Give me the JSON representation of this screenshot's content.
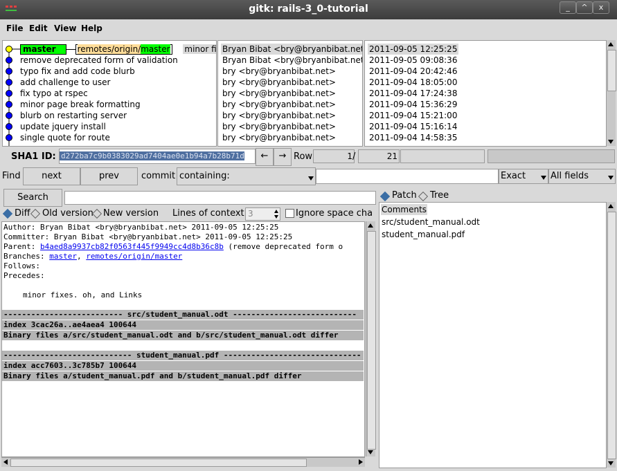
{
  "window": {
    "title": "gitk: rails-3_0-tutorial"
  },
  "menu": [
    "File",
    "Edit",
    "View",
    "Help"
  ],
  "commits": [
    {
      "subject": "minor fixes. o",
      "author": "Bryan Bibat <bry@bryanbibat.net>",
      "date": "2011-09-05 12:25:25"
    },
    {
      "subject": "remove deprecated form of validation",
      "author": "Bryan Bibat <bry@bryanbibat.net>",
      "date": "2011-09-05 09:08:36"
    },
    {
      "subject": "typo fix and add code blurb",
      "author": "bry <bry@bryanbibat.net>",
      "date": "2011-09-04 20:42:46"
    },
    {
      "subject": "add challenge to user",
      "author": "bry <bry@bryanbibat.net>",
      "date": "2011-09-04 18:05:00"
    },
    {
      "subject": "fix typo at rspec",
      "author": "bry <bry@bryanbibat.net>",
      "date": "2011-09-04 17:24:38"
    },
    {
      "subject": "minor page break formatting",
      "author": "bry <bry@bryanbibat.net>",
      "date": "2011-09-04 15:36:29"
    },
    {
      "subject": "blurb on restarting server",
      "author": "bry <bry@bryanbibat.net>",
      "date": "2011-09-04 15:21:00"
    },
    {
      "subject": "update jquery install",
      "author": "bry <bry@bryanbibat.net>",
      "date": "2011-09-04 15:16:14"
    },
    {
      "subject": "single quote for route",
      "author": "bry <bry@bryanbibat.net>",
      "date": "2011-09-04 14:58:35"
    }
  ],
  "refs": {
    "branch": "master",
    "remote_prefix": "remotes/origin/",
    "remote_branch": "master"
  },
  "sha": {
    "label": "SHA1 ID:",
    "value": "d272ba7c9b0383029ad7404ae0e1b94a7b28b71d",
    "row_label": "Row",
    "row_current": "1",
    "row_sep": "/",
    "row_total": "21"
  },
  "find": {
    "label": "Find",
    "next": "next",
    "prev": "prev",
    "commit_label": "commit",
    "mode": "containing:",
    "exact": "Exact",
    "fields": "All fields"
  },
  "search": {
    "button": "Search"
  },
  "diffopts": {
    "diff": "Diff",
    "old": "Old version",
    "new": "New version",
    "context_label": "Lines of context:",
    "context_value": "3",
    "ignore_space": "Ignore space chan"
  },
  "details": {
    "author": "Author: Bryan Bibat <bry@bryanbibat.net>  2011-09-05 12:25:25",
    "committer": "Committer: Bryan Bibat <bry@bryanbibat.net>  2011-09-05 12:25:25",
    "parent_label": "Parent: ",
    "parent_sha": "b4aed8a9937cb82f0563f445f9949cc4d8b36c8b",
    "parent_desc": " (remove deprecated form o",
    "branches_label": "Branches: ",
    "branch1": "master",
    "branch_sep": ", ",
    "branch2": "remotes/origin/master",
    "follows": "Follows:",
    "precedes": "Precedes:",
    "message": "minor fixes. oh, and Links",
    "file1_header": "-------------------------- src/student_manual.odt ---------------------------",
    "file1_index": "index 3cac26a..ae4aea4 100644",
    "file1_binary": "Binary files a/src/student_manual.odt and b/src/student_manual.odt differ",
    "file2_header": "---------------------------- student_manual.pdf ------------------------------",
    "file2_index": "index acc7603..3c785b7 100644",
    "file2_binary": "Binary files a/student_manual.pdf and b/student_manual.pdf differ"
  },
  "tree": {
    "patch": "Patch",
    "tree": "Tree",
    "items": [
      "Comments",
      "src/student_manual.odt",
      "student_manual.pdf"
    ]
  },
  "colors": {
    "branch_bg": "#00ff00",
    "remote_bg": "#ffdd99",
    "node": "#0000ff",
    "head_node": "#ffff00"
  }
}
